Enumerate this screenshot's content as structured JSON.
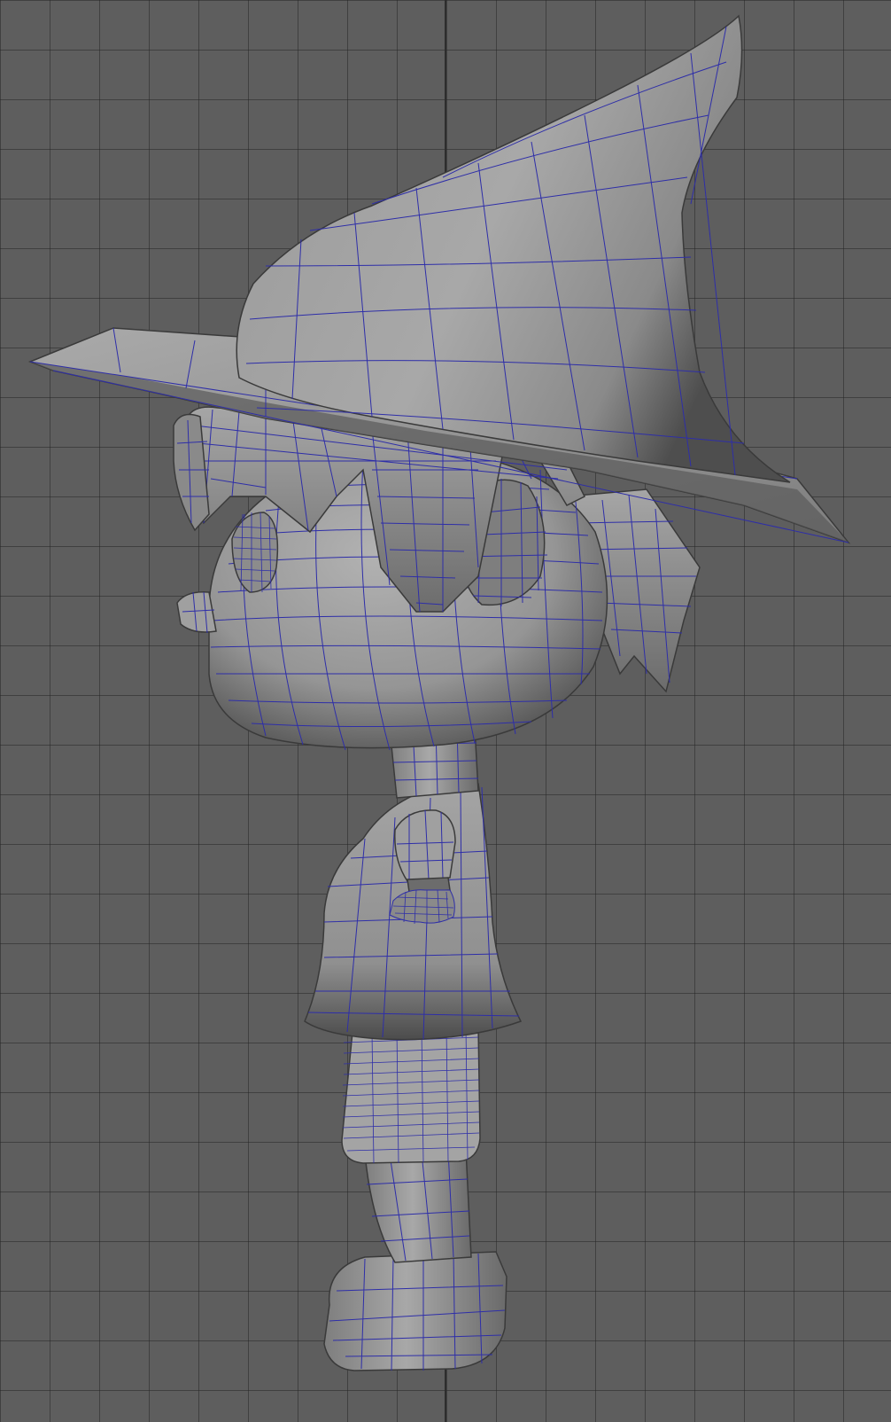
{
  "viewport": {
    "background": "#5e5e5e",
    "grid_color": "#3c3c3c",
    "wire_color": "#2e2ea8",
    "mesh_light": "#b4b4b4",
    "mesh_dark": "#4a4a4a"
  },
  "model": {
    "parts": [
      "witch-hat",
      "hair",
      "head",
      "neck",
      "arm",
      "hand",
      "torso",
      "shorts",
      "leg",
      "shoe"
    ]
  }
}
